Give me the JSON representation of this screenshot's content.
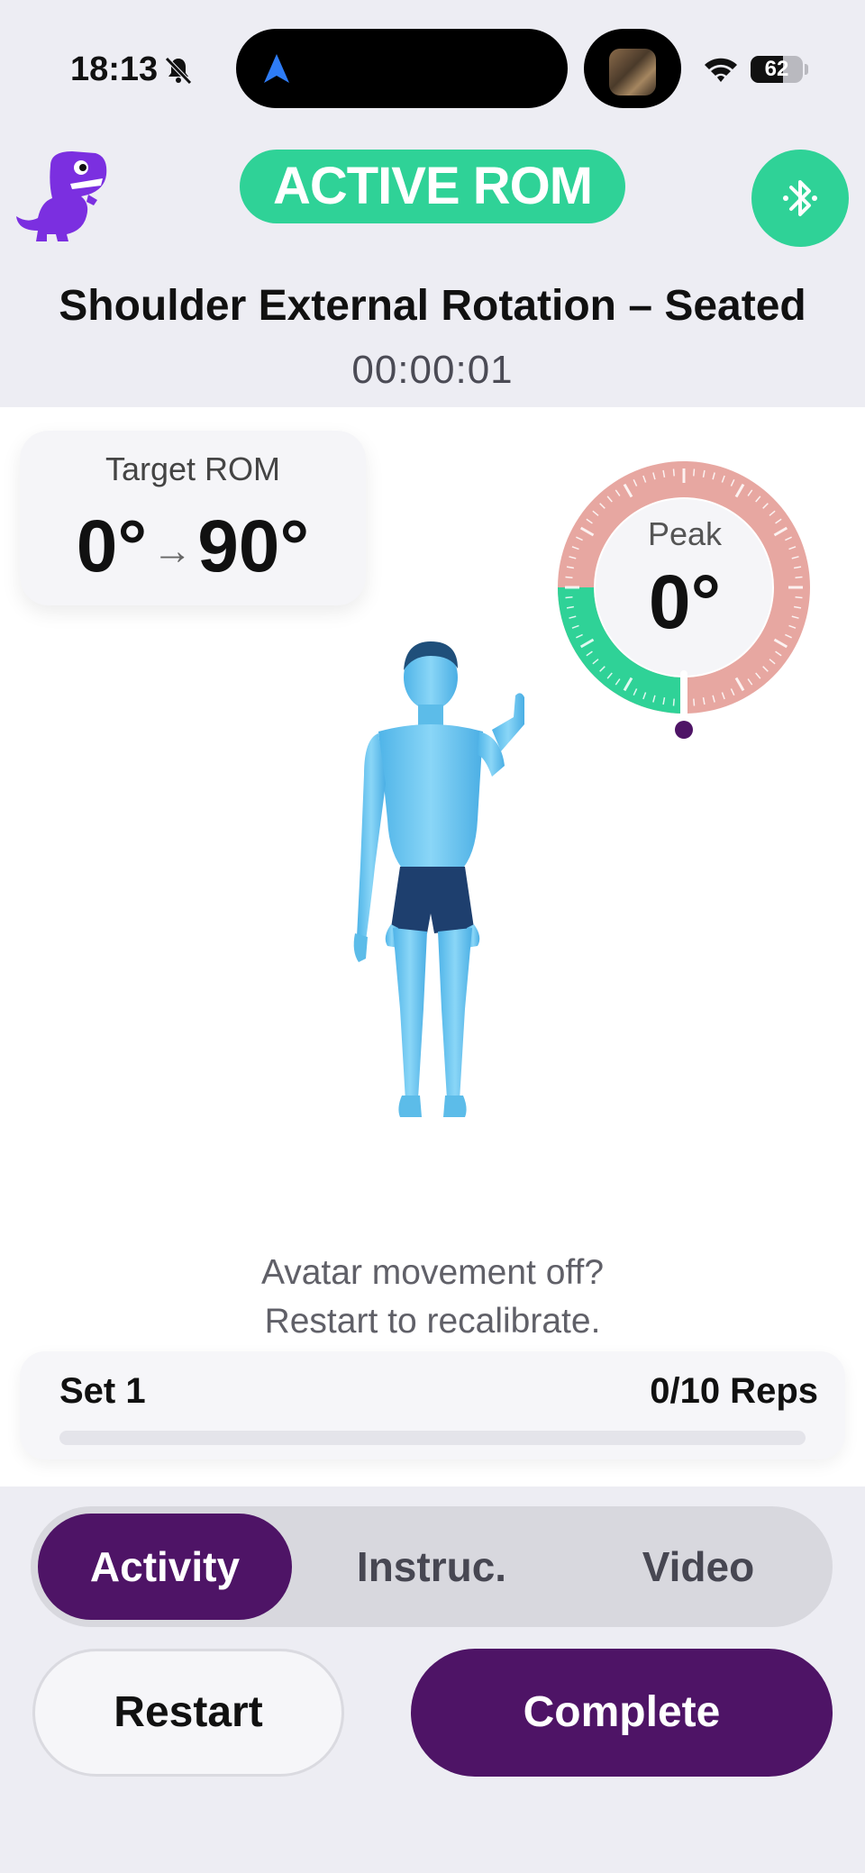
{
  "status_bar": {
    "time": "18:13",
    "battery_percent": "62",
    "battery_level": 0.62,
    "icons": [
      "bell-slash-icon",
      "navigation-arrow-icon",
      "wifi-icon",
      "battery-icon"
    ]
  },
  "header": {
    "logo": "dinosaur-logo-icon",
    "mode_badge": "ACTIVE ROM",
    "bluetooth_icon": "bluetooth-icon",
    "exercise_title": "Shoulder External Rotation – Seated",
    "timer": "00:00:01"
  },
  "target_rom": {
    "label": "Target ROM",
    "start": "0°",
    "arrow": "→",
    "end": "90°"
  },
  "peak": {
    "label": "Peak",
    "value": "0°"
  },
  "hint": {
    "line1": "Avatar movement off?",
    "line2": "Restart to recalibrate."
  },
  "set_progress": {
    "set_label": "Set 1",
    "reps_label": "0/10 Reps",
    "completed": 0,
    "total": 10
  },
  "tabs": [
    {
      "label": "Activity",
      "active": true
    },
    {
      "label": "Instruc.",
      "active": false
    },
    {
      "label": "Video",
      "active": false
    }
  ],
  "actions": {
    "restart": "Restart",
    "complete": "Complete"
  },
  "colors": {
    "accent_green": "#2fd297",
    "primary_purple": "#4e1466",
    "gauge_red": "#e7a7a1",
    "logo_purple": "#7b2fe0",
    "avatar_blue": "#6cc6f2"
  }
}
